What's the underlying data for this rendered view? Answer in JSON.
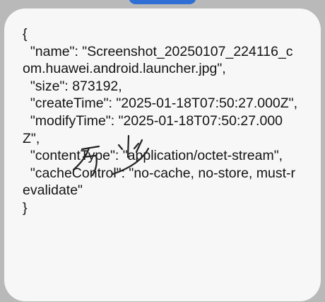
{
  "content": {
    "json_text": "{\n  \"name\": \"Screenshot_20250107_224116_com.huawei.android.launcher.jpg\",\n  \"size\": 873192,\n  \"createTime\": \"2025-01-18T07:50:27.000Z\",\n  \"modifyTime\": \"2025-01-18T07:50:27.000Z\",\n  \"contentType\": \"application/octet-stream\",\n  \"cacheControl\": \"no-cache, no-store, must-revalidate\"\n}"
  },
  "colors": {
    "top_indicator": "#2f6fd6",
    "background": "#b9b9b9",
    "card": "#f7f7f7",
    "text": "#141414"
  }
}
